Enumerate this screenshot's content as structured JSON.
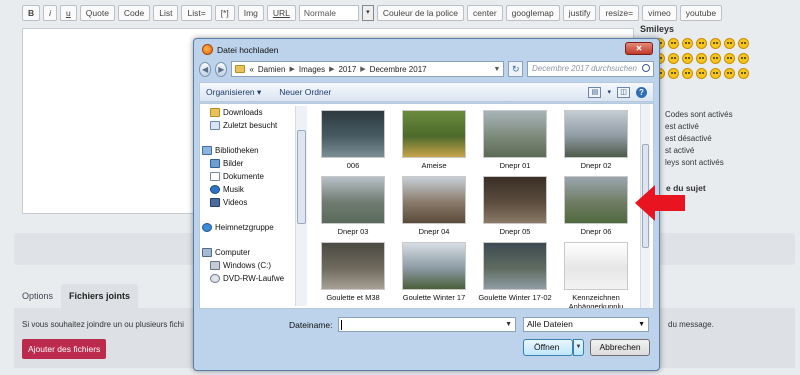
{
  "toolbar": {
    "buttons": [
      "B",
      "i",
      "u",
      "Quote",
      "Code",
      "List",
      "List=",
      "[*]",
      "Img",
      "URL"
    ],
    "font_size_value": "Normale",
    "buttons_after": [
      "Couleur de la police",
      "center",
      "googlemap",
      "justify",
      "resize=",
      "vimeo",
      "youtube"
    ]
  },
  "side": {
    "smileys_title": "Smileys",
    "info": [
      "Codes sont activés",
      "est activé",
      "est désactivé",
      "st activé",
      "leys sont activés"
    ],
    "subject_heading": "e du sujet"
  },
  "tabs": [
    "Options",
    "Fichiers joints"
  ],
  "attachments": {
    "help_text_left": "Si vous souhaitez joindre un ou plusieurs fichi",
    "help_text_right": "du message.",
    "add_files_label": "Ajouter des fichiers"
  },
  "dialog": {
    "title": "Datei hochladen",
    "breadcrumb": [
      "«",
      "Damien",
      "Images",
      "2017",
      "Decembre 2017"
    ],
    "search_placeholder": "Decembre 2017 durchsuchen",
    "commands": {
      "organize": "Organisieren ▾",
      "new_folder": "Neuer Ordner"
    },
    "nav_items": [
      {
        "label": "Downloads",
        "icon": "folder"
      },
      {
        "label": "Zuletzt besucht",
        "icon": "recent"
      },
      {
        "label": "",
        "icon": ""
      },
      {
        "label": "Bibliotheken",
        "icon": "lib"
      },
      {
        "label": "Bilder",
        "icon": "pic"
      },
      {
        "label": "Dokumente",
        "icon": "doc"
      },
      {
        "label": "Musik",
        "icon": "music"
      },
      {
        "label": "Videos",
        "icon": "video"
      },
      {
        "label": "",
        "icon": ""
      },
      {
        "label": "Heimnetzgruppe",
        "icon": "home"
      },
      {
        "label": "",
        "icon": ""
      },
      {
        "label": "Computer",
        "icon": "pc"
      },
      {
        "label": "Windows (C:)",
        "icon": "drive"
      },
      {
        "label": "DVD-RW-Laufwe",
        "icon": "dvd"
      }
    ],
    "files": [
      {
        "name": "006",
        "colors": [
          "#2d3a3f",
          "#7b8f95",
          "#485b63"
        ]
      },
      {
        "name": "Ameise",
        "colors": [
          "#6a8a3d",
          "#c8a34a",
          "#4d6a2b"
        ]
      },
      {
        "name": "Dnepr 01",
        "colors": [
          "#a9b4ba",
          "#5c6a55",
          "#7d8a7a"
        ]
      },
      {
        "name": "Dnepr 02",
        "colors": [
          "#c4ccd4",
          "#4e5a4a",
          "#8f9aa2"
        ]
      },
      {
        "name": "Dnepr 03",
        "colors": [
          "#b8c0c8",
          "#5a6a5c",
          "#6f7b70"
        ]
      },
      {
        "name": "Dnepr 04",
        "colors": [
          "#c7cfd6",
          "#5a4a3a",
          "#8a7a6a"
        ]
      },
      {
        "name": "Dnepr 05",
        "colors": [
          "#3a2e26",
          "#8a7a66",
          "#5b4c3e"
        ]
      },
      {
        "name": "Dnepr 06",
        "colors": [
          "#9aa6ae",
          "#4f6a3e",
          "#6f7d64"
        ]
      },
      {
        "name": "Goulette et M38",
        "colors": [
          "#4a4a42",
          "#a8a296",
          "#6f6a5e"
        ]
      },
      {
        "name": "Goulette Winter 17",
        "colors": [
          "#d7dde3",
          "#4a5f3a",
          "#8c9aa4"
        ]
      },
      {
        "name": "Goulette Winter 17-02",
        "colors": [
          "#3d4a52",
          "#8f9da3",
          "#5f6b60"
        ]
      },
      {
        "name": "Kennzeichnen Anhängerkupplu",
        "colors": [
          "#ffffff",
          "#f3f3f3",
          "#e6e6e6"
        ]
      }
    ],
    "filename_label": "Dateiname:",
    "filename_value": "",
    "filetype_value": "Alle Dateien",
    "open_label": "Öffnen",
    "cancel_label": "Abbrechen"
  },
  "colors": {
    "add_files_button": "#bc2a4d",
    "arrow": "#e8141f",
    "dialog_frame": "#bcd3eb"
  }
}
